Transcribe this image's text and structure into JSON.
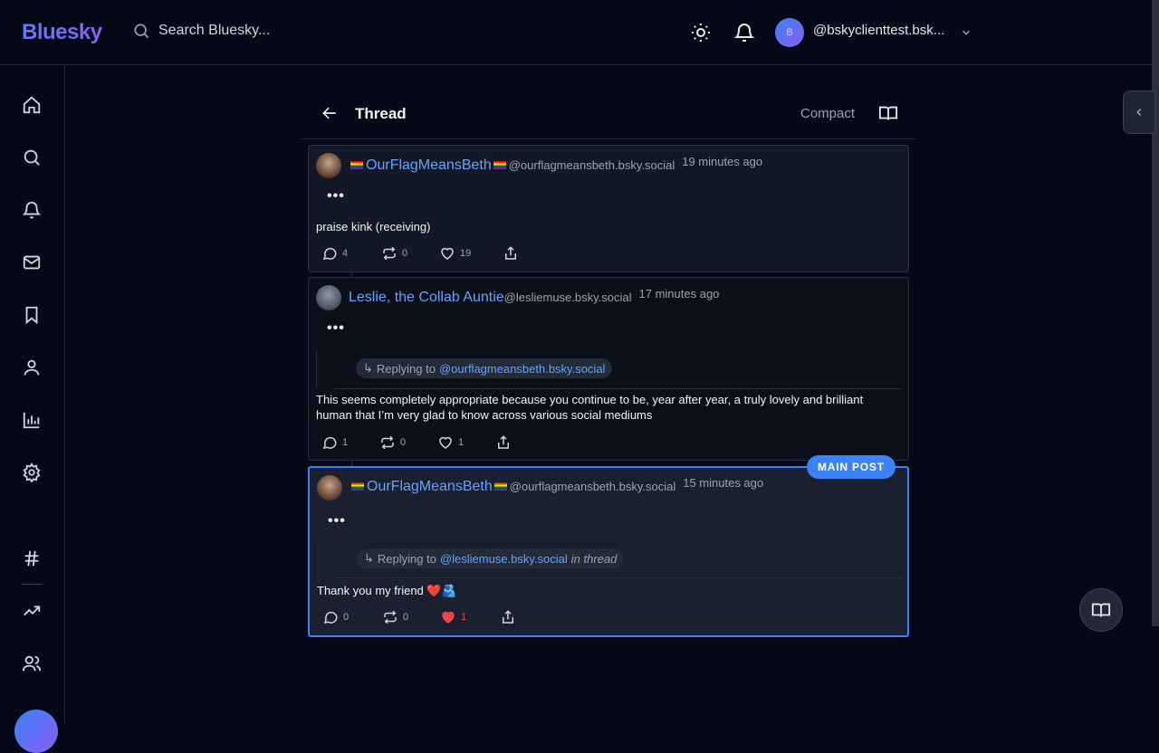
{
  "header": {
    "logo": "Bluesky",
    "search_placeholder": "Search Bluesky...",
    "user_initial": "B",
    "user_handle": "@bskyclienttest.bsk..."
  },
  "thread": {
    "title": "Thread",
    "compact_label": "Compact",
    "main_badge": "MAIN POST"
  },
  "posts": [
    {
      "author": "OurFlagMeansBeth",
      "handle": "@ourflagmeansbeth.bsky.social",
      "time": "19 minutes ago",
      "text": "praise kink (receiving)",
      "replies": "4",
      "reposts": "0",
      "likes": "19"
    },
    {
      "author": "Leslie, the Collab Auntie",
      "handle": "@lesliemuse.bsky.social",
      "time": "17 minutes ago",
      "reply_prefix": "Replying to",
      "reply_to": "@ourflagmeansbeth.bsky.social",
      "text": "This seems completely appropriate because you continue to be, year after year, a truly lovely and brilliant human that I’m very glad to know across various social mediums",
      "replies": "1",
      "reposts": "0",
      "likes": "1"
    },
    {
      "author": "OurFlagMeansBeth",
      "handle": "@ourflagmeansbeth.bsky.social",
      "time": "15 minutes ago",
      "reply_prefix": "Replying to",
      "reply_to": "@lesliemuse.bsky.social",
      "reply_suffix": "in thread",
      "text": "Thank you my friend ❤️🫂",
      "replies": "0",
      "reposts": "0",
      "likes": "1"
    }
  ],
  "colors": {
    "accent": "#3b82f6",
    "name": "#60a5fa",
    "like_active": "#ef4444",
    "background": "#050816"
  }
}
